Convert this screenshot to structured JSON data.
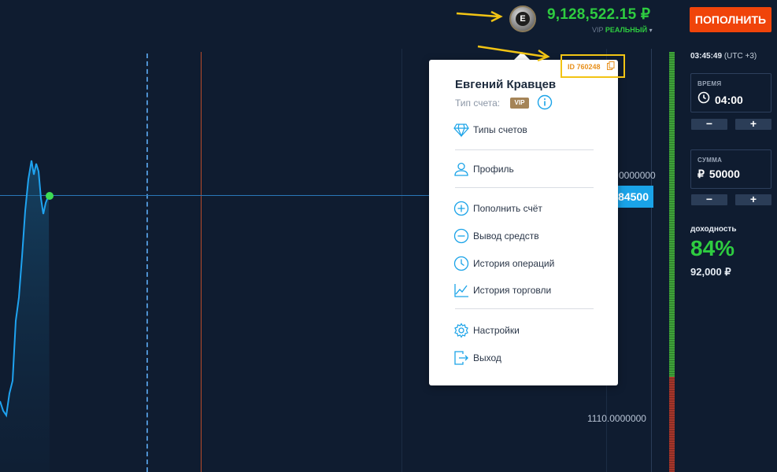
{
  "header": {
    "avatar_letter": "E",
    "balance": "9,128,522.15 ₽",
    "account_vip": "VIP",
    "account_type": "РЕАЛЬНЫЙ",
    "account_arrow": "▾",
    "deposit_label": "ПОПОЛНИТЬ"
  },
  "chart": {
    "axis_top": "0000000",
    "axis_bottom": "1110.0000000",
    "current_price": "84500",
    "line_color": "#1fa3f0",
    "point_color": "#3ddc54"
  },
  "dropdown": {
    "id_label": "ID 760248",
    "user_name": "Евгений Кравцев",
    "account_type_label": "Тип счета:",
    "vip_badge": "VIP",
    "items": [
      {
        "label": "Типы счетов",
        "icon": "diamond-icon"
      },
      {
        "label": "Профиль",
        "icon": "user-icon"
      },
      {
        "label": "Пополнить счёт",
        "icon": "plus-circle-icon"
      },
      {
        "label": "Вывод средств",
        "icon": "minus-circle-icon"
      },
      {
        "label": "История операций",
        "icon": "clock-icon"
      },
      {
        "label": "История торговли",
        "icon": "chart-line-icon"
      },
      {
        "label": "Настройки",
        "icon": "gear-icon"
      },
      {
        "label": "Выход",
        "icon": "logout-icon"
      }
    ]
  },
  "sidebar": {
    "time": "03:45:49",
    "timezone": "(UTC +3)",
    "duration_label": "ВРЕМЯ",
    "duration_value": "04:00",
    "amount_label": "СУММА",
    "amount_currency": "₽",
    "amount_value": "50000",
    "minus": "−",
    "plus": "+",
    "yield_label": "доходность",
    "yield_value": "84%",
    "payout": "92,000 ₽"
  },
  "colors": {
    "accent_orange": "#f0440a",
    "profit_green": "#2ecc40",
    "highlight_yellow": "#f2c414",
    "background": "#0f1c30"
  }
}
